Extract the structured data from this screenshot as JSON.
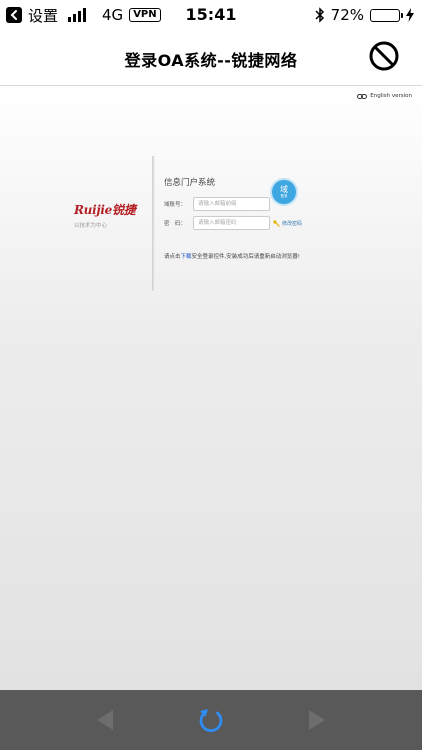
{
  "status_bar": {
    "back_app_label": "设置",
    "network": "4G",
    "vpn": "VPN",
    "time": "15:41",
    "battery_percent": "72%",
    "battery_level": 0.72,
    "icons": [
      "chevron-left-icon",
      "signal-icon",
      "bluetooth-icon",
      "battery-icon",
      "charging-bolt-icon"
    ]
  },
  "nav": {
    "title": "登录OA系统--锐捷网络",
    "stop_icon": "stop-icon"
  },
  "page": {
    "english_link": "English version",
    "logo": {
      "brand": "Ruijie锐捷",
      "subtitle": "以技术为中心"
    },
    "login": {
      "title": "信息门户系统",
      "badge_main": "域",
      "badge_sub": "登录",
      "username_label": "域账号：",
      "username_placeholder": "请输入邮箱前缀",
      "password_label": "密　码：",
      "password_placeholder": "请输入邮箱密码",
      "change_password": "修改密码"
    },
    "notice": {
      "before": "请点击",
      "link": "下载",
      "after": "安全登录控件,安装成功后请重新启动浏览器!"
    }
  },
  "toolbar": {
    "icons": [
      "back-icon",
      "reload-icon",
      "forward-icon"
    ],
    "reload_color": "#2f8cf0"
  }
}
